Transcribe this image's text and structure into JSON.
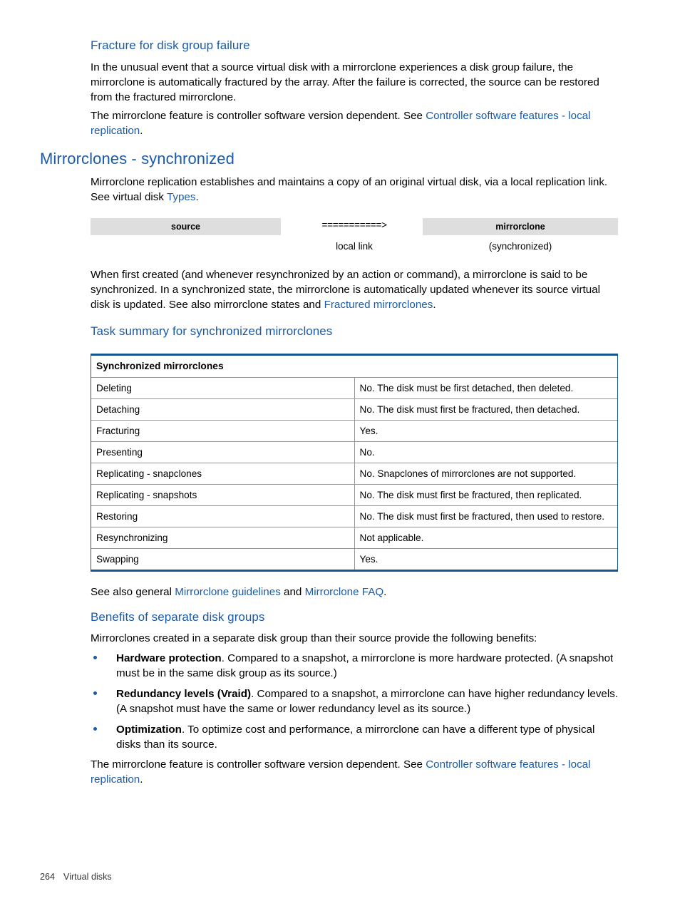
{
  "page": {
    "footer_page_number": "264",
    "footer_chapter": "Virtual disks",
    "heading_color": "#1a5ba8",
    "link_color": "#1a5ba8",
    "table_border_color": "#14558f",
    "table_rule_color": "#6e9ec9",
    "diagram_box_color": "#dedede"
  },
  "section_fracture": {
    "heading": "Fracture for disk group failure",
    "para1_part1": "In the unusual event that a source virtual disk with a mirrorclone experiences a disk group failure, the mirrorclone is automatically fractured by the array. After the failure is corrected, the source can be restored from the fractured mirrorclone.",
    "para2_part1": "The mirrorclone feature is controller software version dependent. See ",
    "para2_link": "Controller software features - local replication",
    "para2_part2": "."
  },
  "section_mirrorclones": {
    "heading": "Mirrorclones - synchronized",
    "intro_part1": "Mirrorclone replication establishes and maintains a copy of an original virtual disk, via a local replication link. See virtual disk ",
    "intro_link": "Types",
    "intro_part2": ".",
    "diagram": {
      "source_label": "source",
      "arrow": "===========>",
      "arrow_caption": "local link",
      "mirrorclone_label": "mirrorclone",
      "mirrorclone_caption": "(synchronized)"
    },
    "body_part1": "When first created (and whenever resynchronized by an action or command), a mirrorclone is said to be synchronized. In a synchronized state, the mirrorclone is automatically updated whenever its source virtual disk is updated. See also mirrorclone states and ",
    "body_link": "Fractured mirrorclones",
    "body_part2": "."
  },
  "task_summary": {
    "heading": "Task summary for synchronized mirrorclones",
    "table": {
      "header": "Synchronized mirrorclones",
      "rows": [
        {
          "task": "Deleting",
          "result": "No. The disk must be first detached, then deleted."
        },
        {
          "task": "Detaching",
          "result": "No. The disk must first be fractured, then detached."
        },
        {
          "task": "Fracturing",
          "result": "Yes."
        },
        {
          "task": "Presenting",
          "result": "No."
        },
        {
          "task": "Replicating - snapclones",
          "result": "No. Snapclones of mirrorclones are not supported."
        },
        {
          "task": "Replicating - snapshots",
          "result": "No. The disk must first be fractured, then replicated."
        },
        {
          "task": "Restoring",
          "result": "No. The disk must first be fractured, then used to restore."
        },
        {
          "task": "Resynchronizing",
          "result": "Not applicable."
        },
        {
          "task": "Swapping",
          "result": "Yes."
        }
      ]
    },
    "see_also_part1": "See also general ",
    "see_also_link1": "Mirrorclone guidelines",
    "see_also_part2": " and ",
    "see_also_link2": "Mirrorclone FAQ",
    "see_also_part3": "."
  },
  "section_benefits": {
    "heading": "Benefits of separate disk groups",
    "intro": "Mirrorclones created in a separate disk group than their source provide the following benefits:",
    "bullets": [
      {
        "term": "Hardware protection",
        "text": ". Compared to a snapshot, a mirrorclone is more hardware protected. (A snapshot must be in the same disk group as its source.)"
      },
      {
        "term": "Redundancy levels (Vraid)",
        "text": ". Compared to a snapshot, a mirrorclone can have higher redundancy levels. (A snapshot must have the same or lower redundancy level as its source.)"
      },
      {
        "term": "Optimization",
        "text": ". To optimize cost and performance, a mirrorclone can have a different type of physical disks than its source."
      }
    ],
    "closing_part1": "The mirrorclone feature is controller software version dependent. See ",
    "closing_link": "Controller software features - local replication",
    "closing_part2": "."
  }
}
